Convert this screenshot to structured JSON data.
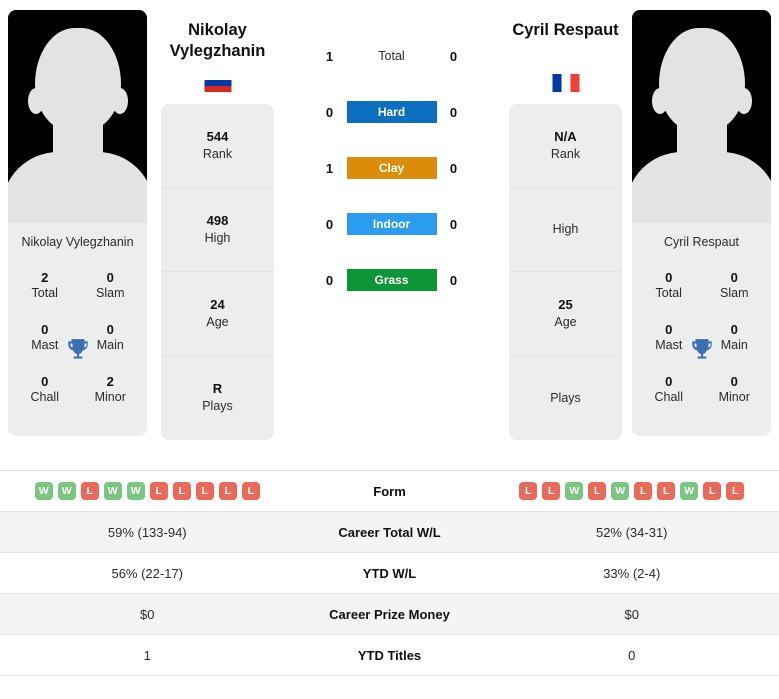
{
  "players": {
    "left": {
      "name_line1": "Nikolay",
      "name_line2": "Vylegzhanin",
      "full_name": "Nikolay Vylegzhanin",
      "country": "Russia",
      "flag_icon": "flag-russia-icon",
      "photo_label": "player-photo-placeholder",
      "titles": [
        {
          "value": "2",
          "label": "Total"
        },
        {
          "value": "0",
          "label": "Slam"
        },
        {
          "value": "0",
          "label": "Mast"
        },
        {
          "value": "0",
          "label": "Main"
        },
        {
          "value": "0",
          "label": "Chall"
        },
        {
          "value": "2",
          "label": "Minor"
        }
      ],
      "stats": [
        {
          "value": "544",
          "label": "Rank"
        },
        {
          "value": "498",
          "label": "High"
        },
        {
          "value": "24",
          "label": "Age"
        },
        {
          "value": "R",
          "label": "Plays"
        }
      ],
      "form": [
        "W",
        "W",
        "L",
        "W",
        "W",
        "L",
        "L",
        "L",
        "L",
        "L"
      ],
      "career_total_wl": "59% (133-94)",
      "ytd_wl": "56% (22-17)",
      "career_prize_money": "$0",
      "ytd_titles": "1"
    },
    "right": {
      "name_line1": "Cyril Respaut",
      "name_line2": "",
      "full_name": "Cyril Respaut",
      "country": "France",
      "flag_icon": "flag-france-icon",
      "photo_label": "player-photo-placeholder",
      "titles": [
        {
          "value": "0",
          "label": "Total"
        },
        {
          "value": "0",
          "label": "Slam"
        },
        {
          "value": "0",
          "label": "Mast"
        },
        {
          "value": "0",
          "label": "Main"
        },
        {
          "value": "0",
          "label": "Chall"
        },
        {
          "value": "0",
          "label": "Minor"
        }
      ],
      "stats": [
        {
          "value": "N/A",
          "label": "Rank"
        },
        {
          "value": "",
          "label": "High"
        },
        {
          "value": "25",
          "label": "Age"
        },
        {
          "value": "",
          "label": "Plays"
        }
      ],
      "form": [
        "L",
        "L",
        "W",
        "L",
        "W",
        "L",
        "L",
        "W",
        "L",
        "L"
      ],
      "career_total_wl": "52% (34-31)",
      "ytd_wl": "33% (2-4)",
      "career_prize_money": "$0",
      "ytd_titles": "0"
    }
  },
  "head_to_head": [
    {
      "label": "Total",
      "left": "1",
      "right": "0",
      "color": "",
      "pill": false
    },
    {
      "label": "Hard",
      "left": "0",
      "right": "0",
      "color": "#0c6fc0",
      "pill": true
    },
    {
      "label": "Clay",
      "left": "1",
      "right": "0",
      "color": "#dd8c07",
      "pill": true
    },
    {
      "label": "Indoor",
      "left": "0",
      "right": "0",
      "color": "#2c9cf0",
      "pill": true
    },
    {
      "label": "Grass",
      "left": "0",
      "right": "0",
      "color": "#0d9637",
      "pill": true
    }
  ],
  "table": {
    "rows": [
      {
        "label": "Form",
        "type": "form"
      },
      {
        "label": "Career Total W/L",
        "type": "text",
        "key": "career_total_wl"
      },
      {
        "label": "YTD W/L",
        "type": "text",
        "key": "ytd_wl"
      },
      {
        "label": "Career Prize Money",
        "type": "text",
        "key": "career_prize_money"
      },
      {
        "label": "YTD Titles",
        "type": "text",
        "key": "ytd_titles"
      }
    ]
  },
  "theme": {
    "win_color": "#7ac77f",
    "loss_color": "#ea6a5a",
    "card_bg": "#eceded",
    "alt_row_bg": "#f4f4f4",
    "trophy_color": "#3c6fb4"
  }
}
